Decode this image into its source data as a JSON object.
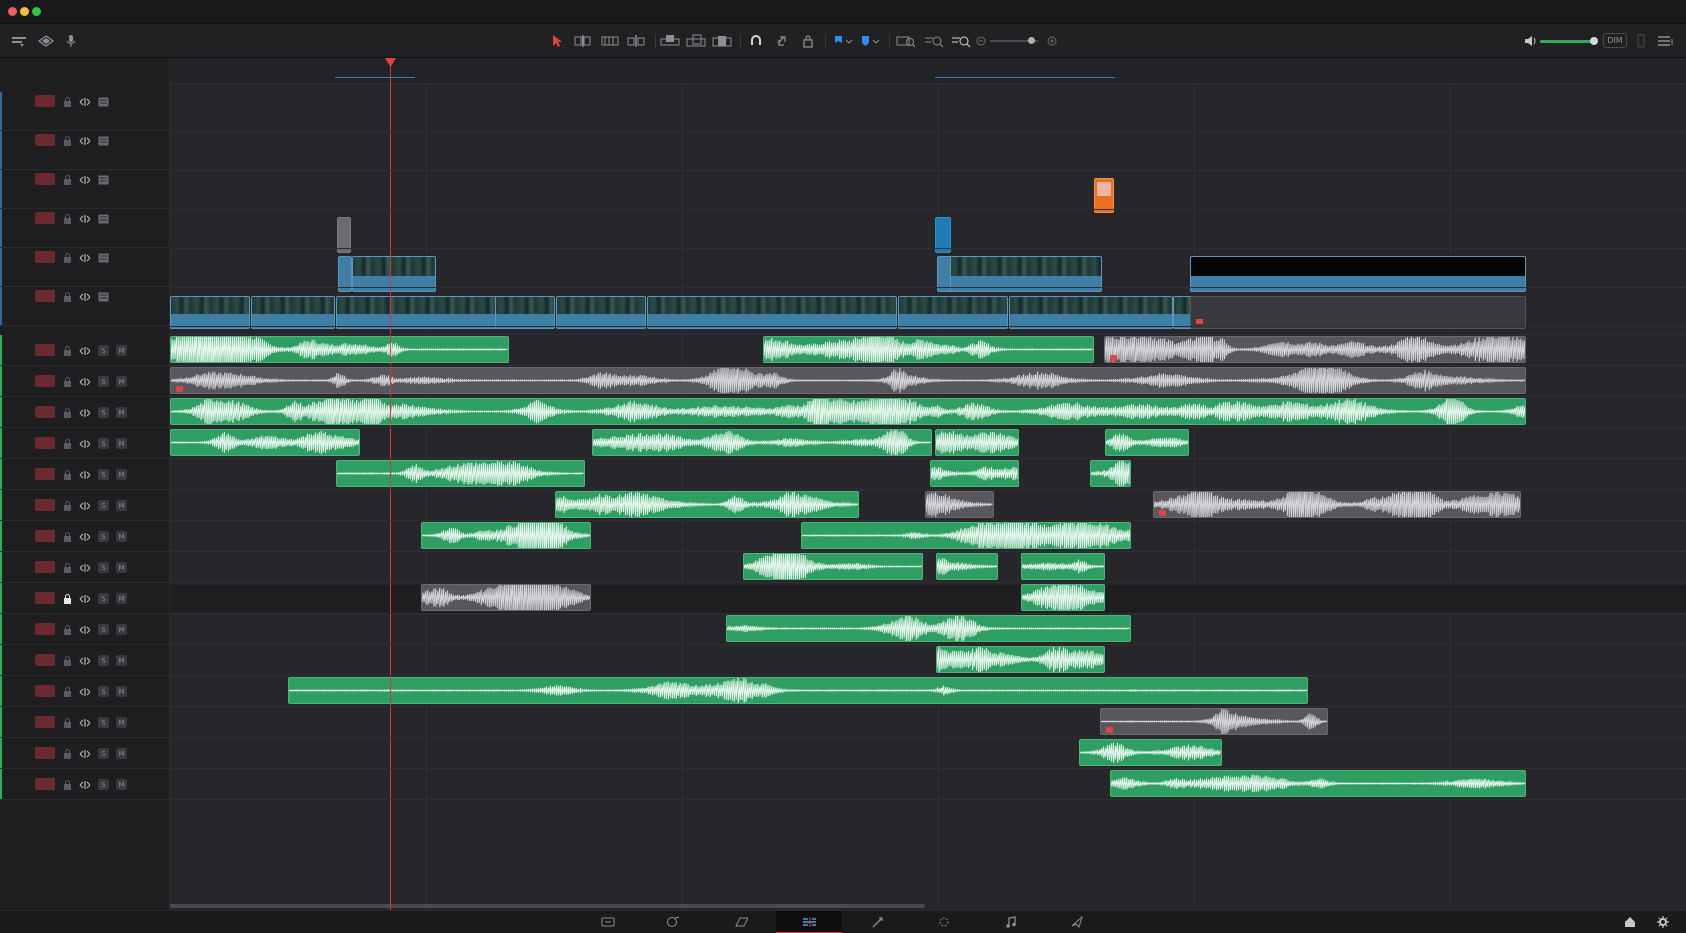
{
  "toolbar": {
    "left_icons": [
      "timeline-view-icon",
      "ripple-icon",
      "microphone-icon"
    ],
    "edit_tools": [
      "selection-arrow-icon",
      "trim-edit-icon",
      "dynamic-trim-icon",
      "blade-icon",
      "insert-icon",
      "overwrite-icon",
      "replace-icon",
      "snapping-icon",
      "linked-selection-icon",
      "position-lock-icon",
      "flag-icon",
      "marker-icon",
      "zoom-full-icon",
      "zoom-detail-icon",
      "zoom-custom-icon",
      "zoom-out-icon",
      "zoom-in-icon"
    ],
    "dim_label": "DIM",
    "volume_level": 0.9
  },
  "tracks": {
    "video_count": 6,
    "audio_count": 15,
    "solo_label": "S",
    "mute_label": "M",
    "locked_audio_index": 8
  },
  "pages": [
    "media-page-icon",
    "cut-page-icon",
    "edit-page-icon",
    "fairlight-timeline-icon",
    "color-page-icon",
    "fusion-page-icon",
    "fairlight-page-icon",
    "deliver-page-icon"
  ],
  "active_page": "fairlight-timeline-icon",
  "corner_icons": [
    "home-icon",
    "settings-icon"
  ],
  "colors": {
    "audio_clip": "#2f9e63",
    "muted_clip": "#58585c",
    "video_clip": "#3f7ea6",
    "playhead": "#d23b3b",
    "track_swatch": "#6b2a2e"
  }
}
